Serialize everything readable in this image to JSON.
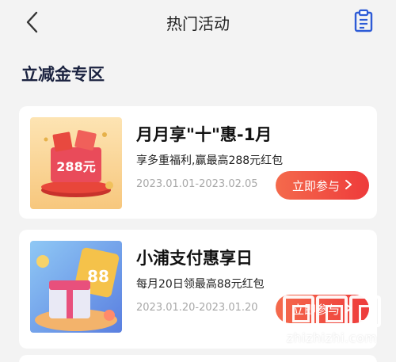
{
  "header": {
    "title": "热门活动",
    "back_icon": "chevron-left-icon",
    "right_icon": "clipboard-icon"
  },
  "section": {
    "title": "立减金专区"
  },
  "cards": [
    {
      "title": "月月享\"十\"惠-1月",
      "subtitle": "享多重福利,赢最高288元红包",
      "date": "2023.01.01-2023.02.05",
      "button": "立即参与",
      "thumb_text": "288元"
    },
    {
      "title": "小浦支付惠享日",
      "subtitle": "每月20日领最高88元红包",
      "date": "2023.01.20-2023.01.20",
      "button": "立即参与",
      "thumb_text": "88"
    }
  ],
  "watermark": {
    "text": "zhizhizhi.com"
  },
  "colors": {
    "accent": "#ef4a3f",
    "page_bg": "#f3f3f3"
  }
}
